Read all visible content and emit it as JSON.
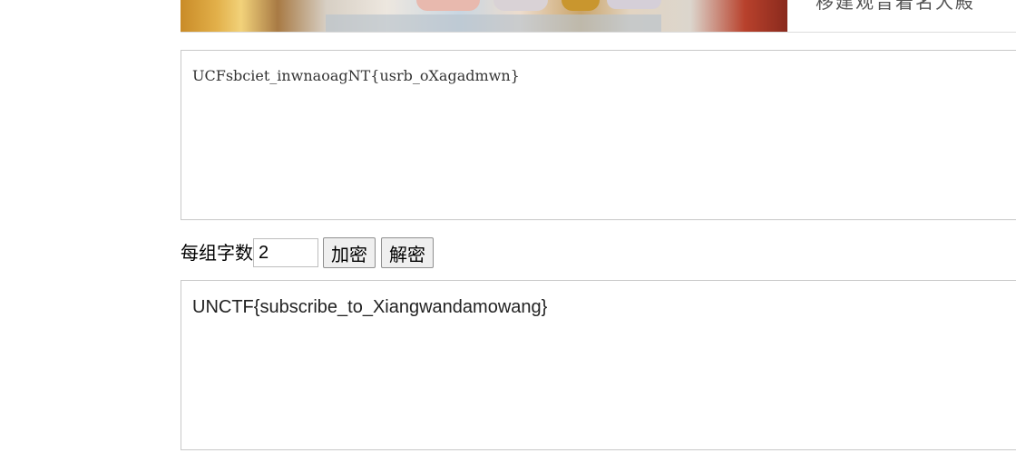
{
  "banner": {
    "caption": "移建观音着名大殿"
  },
  "cipher_box": {
    "value": "UCFsbciet_inwnaoagNT{usrb_oXagadmwn}"
  },
  "controls": {
    "group_size_label": "每组字数",
    "group_size_value": "2",
    "encrypt_label": "加密",
    "decrypt_label": "解密"
  },
  "plain_box": {
    "value": "UNCTF{subscribe_to_Xiangwandamowang}"
  }
}
